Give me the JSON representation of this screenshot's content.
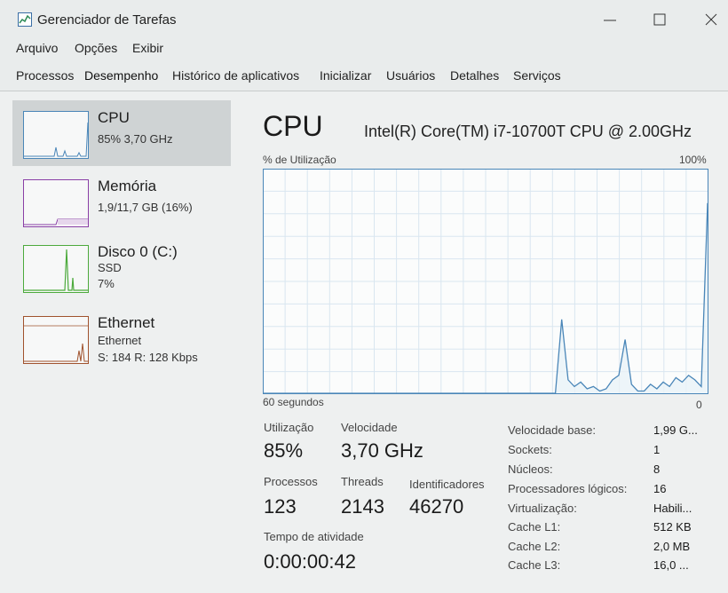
{
  "window": {
    "title": "Gerenciador de Tarefas"
  },
  "menu": [
    "Arquivo",
    "Opções",
    "Exibir"
  ],
  "tabs": [
    "Processos",
    "Desempenho",
    "Histórico de aplicativos",
    "Inicializar",
    "Usuários",
    "Detalhes",
    "Serviços"
  ],
  "active_tab": "Desempenho",
  "sidebar": [
    {
      "name": "CPU",
      "lines": [
        "85% 3,70 GHz"
      ]
    },
    {
      "name": "Memória",
      "lines": [
        "1,9/11,7 GB (16%)"
      ]
    },
    {
      "name": "Disco 0 (C:)",
      "lines": [
        "SSD",
        "7%"
      ]
    },
    {
      "name": "Ethernet",
      "lines": [
        "Ethernet",
        "S: 184 R: 128 Kbps"
      ]
    }
  ],
  "main": {
    "title": "CPU",
    "model": "Intel(R) Core(TM) i7-10700T CPU @ 2.00GHz",
    "graph_label_left": "% de Utilização",
    "graph_label_right": "100%",
    "graph_time_label": "60 segundos",
    "graph_zero_label": "0",
    "graph_series": [
      0,
      0,
      0,
      0,
      0,
      0,
      0,
      0,
      0,
      0,
      0,
      0,
      0,
      0,
      0,
      0,
      0,
      0,
      0,
      0,
      0,
      0,
      0,
      0,
      0,
      0,
      0,
      0,
      0,
      0,
      0,
      0,
      0,
      0,
      0,
      0,
      0,
      0,
      0,
      0,
      0,
      0,
      0,
      0,
      0,
      0,
      0,
      33,
      6,
      3,
      5,
      2,
      3,
      1,
      2,
      6,
      8,
      24,
      4,
      1,
      1,
      4,
      2,
      5,
      3,
      7,
      5,
      8,
      6,
      3,
      85
    ]
  },
  "stats": {
    "utilizacao_label": "Utilização",
    "utilizacao_value": "85%",
    "velocidade_label": "Velocidade",
    "velocidade_value": "3,70 GHz",
    "processos_label": "Processos",
    "processos_value": "123",
    "threads_label": "Threads",
    "threads_value": "2143",
    "identificadores_label": "Identificadores",
    "identificadores_value": "46270",
    "tempo_label": "Tempo de atividade",
    "tempo_value": "0:00:00:42"
  },
  "specs": [
    {
      "label": "Velocidade base:",
      "value": "1,99 G..."
    },
    {
      "label": "Sockets:",
      "value": "1"
    },
    {
      "label": "Núcleos:",
      "value": "8"
    },
    {
      "label": "Processadores lógicos:",
      "value": "16"
    },
    {
      "label": "Virtualização:",
      "value": "Habili..."
    },
    {
      "label": "Cache L1:",
      "value": "512 KB"
    },
    {
      "label": "Cache L2:",
      "value": "2,0 MB"
    },
    {
      "label": "Cache L3:",
      "value": "16,0 ..."
    }
  ],
  "colors": {
    "cpu": "#4a86b8",
    "memory": "#8a3fa6",
    "disk": "#4caa3c",
    "ethernet": "#a0522d"
  }
}
